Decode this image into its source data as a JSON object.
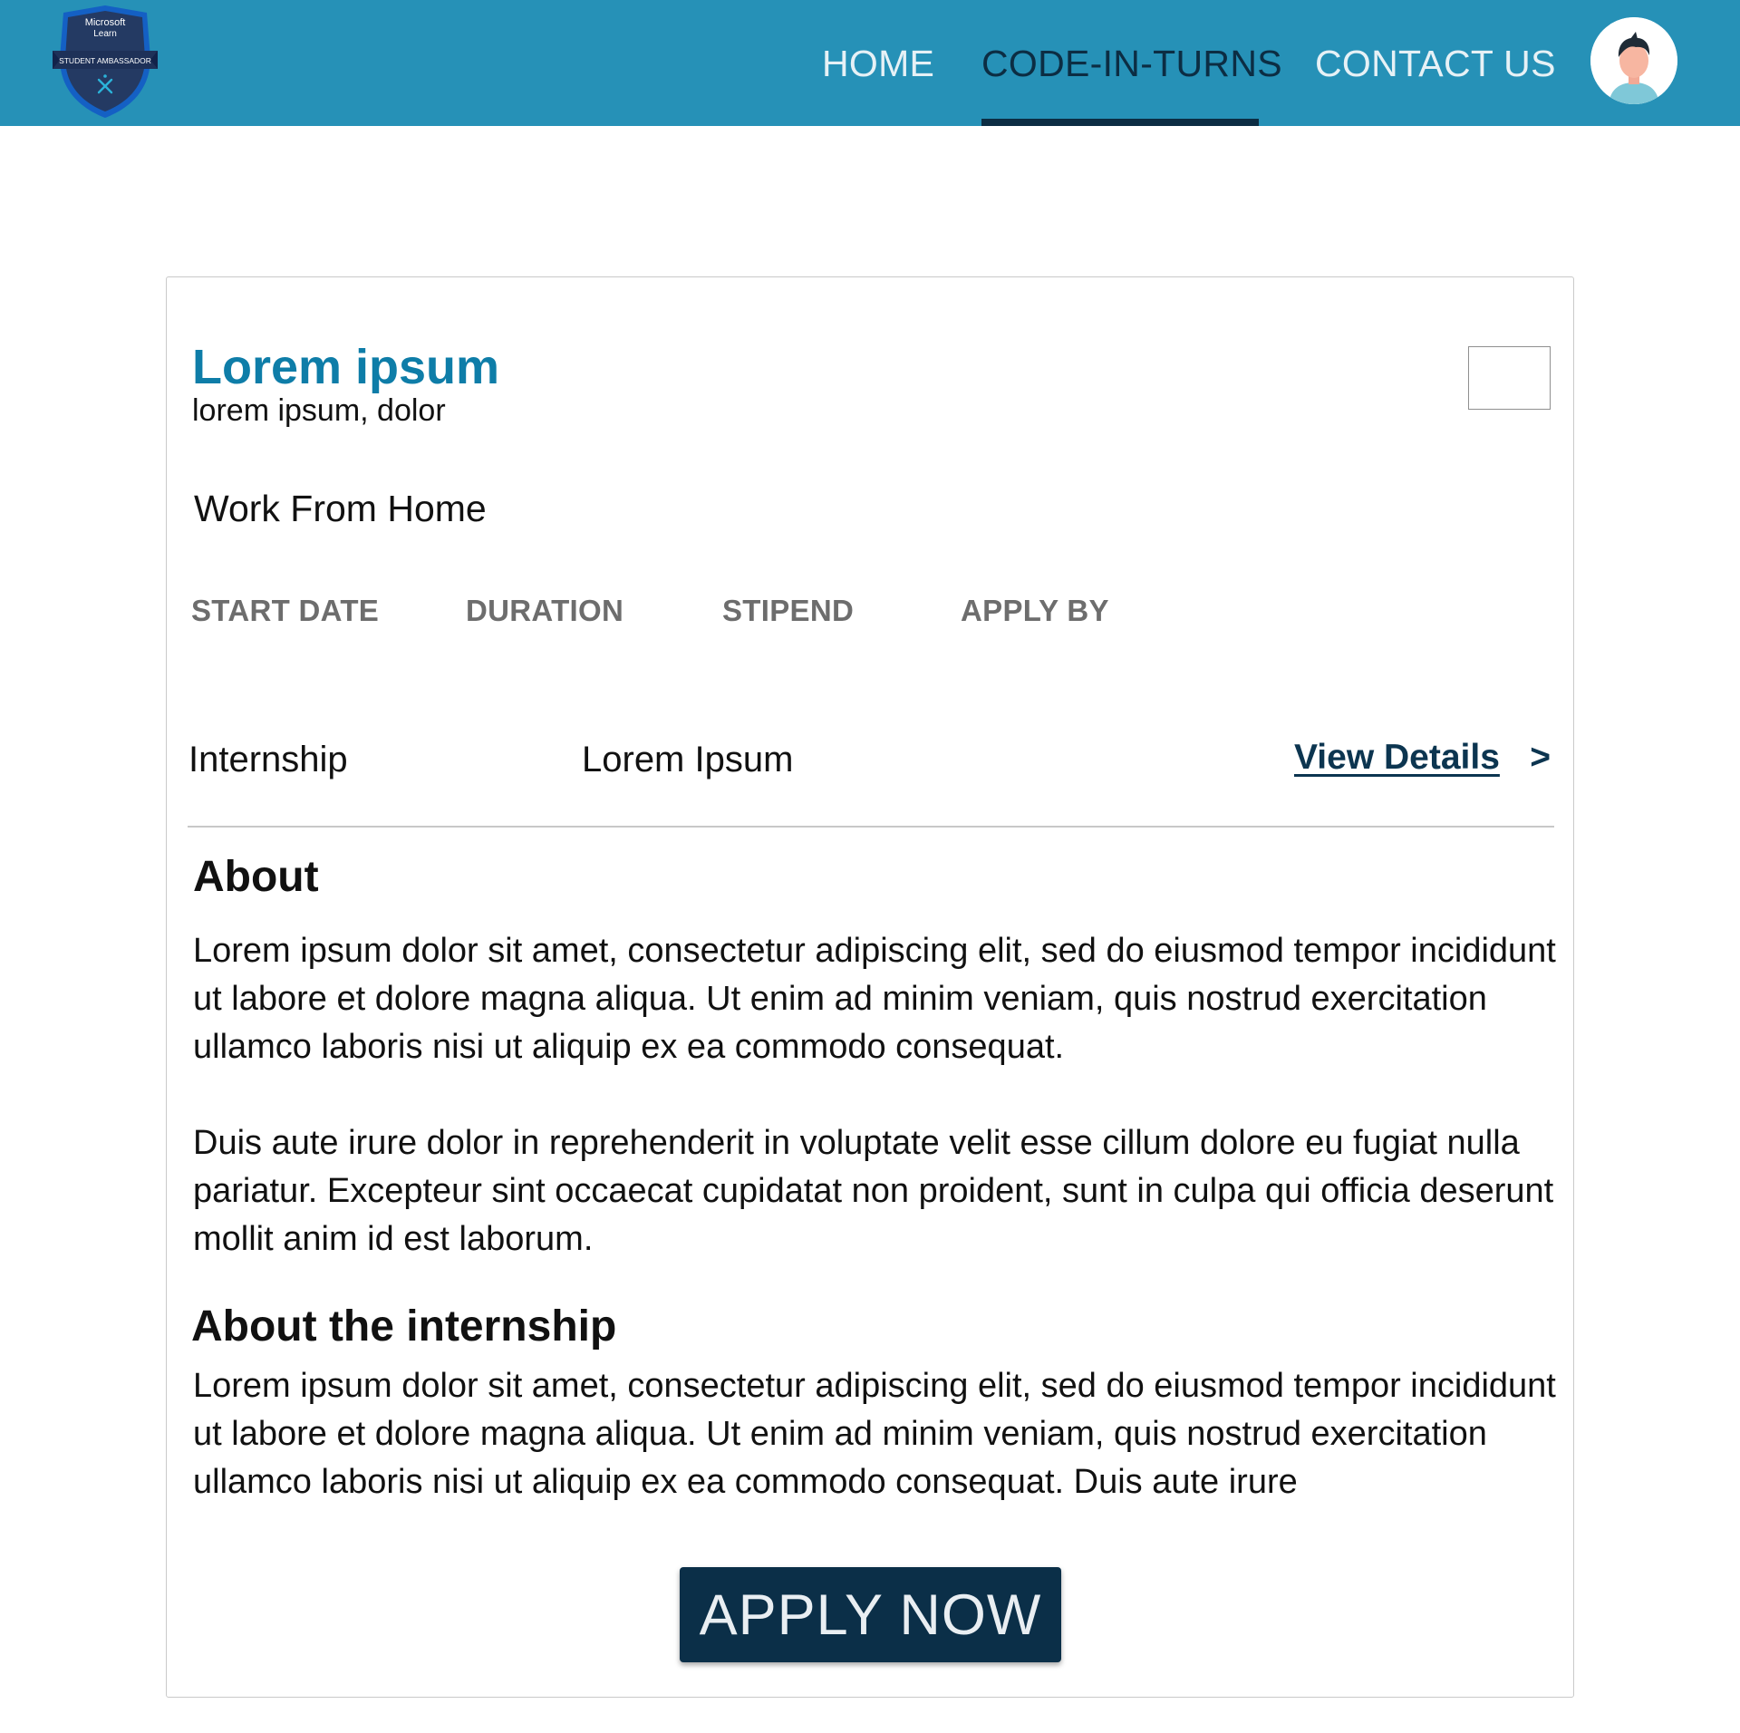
{
  "header": {
    "logo": {
      "line1": "Microsoft",
      "line2": "Learn",
      "ribbon": "STUDENT AMBASSADOR",
      "colors": {
        "outer": "#1460c4",
        "inner": "#243a63",
        "ribbon": "#1e3158"
      }
    },
    "nav": {
      "home": "HOME",
      "code_in_turns": "CODE-IN-TURNS",
      "contact_us": "CONTACT US",
      "active": "CODE-IN-TURNS"
    },
    "avatar_icon": "user-avatar-icon"
  },
  "listing": {
    "title": "Lorem ipsum",
    "subtitle": "lorem ipsum, dolor",
    "location": "Work From Home",
    "meta_labels": {
      "start_date": "START DATE",
      "duration": "DURATION",
      "stipend": "STIPEND",
      "apply_by": "APPLY BY"
    },
    "type": "Internship",
    "company": "Lorem Ipsum",
    "view_details": "View Details",
    "view_details_arrow": ">"
  },
  "about": {
    "heading": "About",
    "paragraph1": "Lorem ipsum dolor sit amet, consectetur adipiscing elit, sed do eiusmod tempor incididunt ut labore et dolore magna aliqua. Ut enim ad minim veniam, quis nostrud exercitation ullamco laboris nisi ut aliquip ex ea commodo consequat.",
    "paragraph2": "Duis aute irure dolor in reprehenderit in voluptate velit esse cillum dolore eu fugiat nulla pariatur. Excepteur sint occaecat cupidatat non proident, sunt in culpa qui officia deserunt mollit anim id est laborum."
  },
  "about_internship": {
    "heading": "About the internship",
    "paragraph": "Lorem ipsum dolor sit amet, consectetur adipiscing elit, sed do eiusmod tempor incididunt ut labore et dolore magna aliqua. Ut enim ad minim veniam, quis nostrud exercitation ullamco laboris nisi ut aliquip ex ea commodo consequat. Duis aute irure"
  },
  "apply_button": "APPLY NOW",
  "colors": {
    "header_bg": "#2691b7",
    "nav_active": "#0c2d43",
    "title": "#0e7da8",
    "button_bg": "#0b2f48",
    "meta_label": "#6d6d6d"
  }
}
